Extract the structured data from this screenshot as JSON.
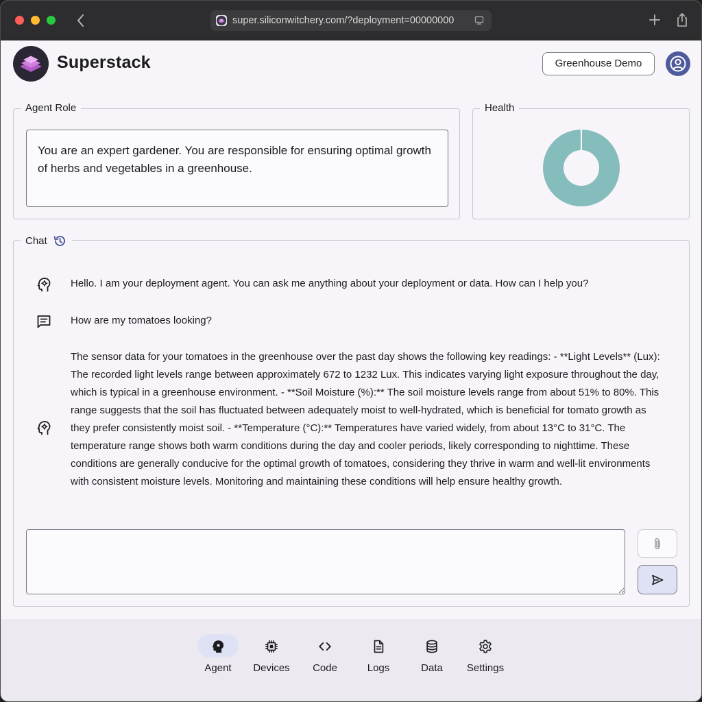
{
  "browser": {
    "url": "super.siliconwitchery.com/?deployment=00000000"
  },
  "header": {
    "brand": "Superstack",
    "deployment_button": "Greenhouse Demo"
  },
  "agent_role": {
    "legend": "Agent Role",
    "text": "You are an expert gardener. You are responsible for ensuring optimal growth of herbs and vegetables in a greenhouse."
  },
  "health": {
    "legend": "Health",
    "segments": [
      {
        "fraction": 0.99,
        "color": "#85bcbc"
      },
      {
        "fraction": 0.01,
        "color": "#ffffff"
      }
    ]
  },
  "chat": {
    "legend": "Chat",
    "messages": [
      {
        "role": "agent",
        "icon": "agent-head-icon",
        "text": "Hello. I am your deployment agent. You can ask me anything about your deployment or data. How can I help you?"
      },
      {
        "role": "user",
        "icon": "chat-bubble-icon",
        "text": "How are my tomatoes looking?"
      },
      {
        "role": "agent",
        "icon": "agent-head-icon",
        "text": "The sensor data for your tomatoes in the greenhouse over the past day shows the following key readings: - **Light Levels** (Lux): The recorded light levels range between approximately 672 to 1232 Lux. This indicates varying light exposure throughout the day, which is typical in a greenhouse environment. - **Soil Moisture (%):** The soil moisture levels range from about 51% to 80%. This range suggests that the soil has fluctuated between adequately moist to well-hydrated, which is beneficial for tomato growth as they prefer consistently moist soil. - **Temperature (°C):** Temperatures have varied widely, from about 13°C to 31°C. The temperature range shows both warm conditions during the day and cooler periods, likely corresponding to nighttime. These conditions are generally conducive for the optimal growth of tomatoes, considering they thrive in warm and well-lit environments with consistent moisture levels. Monitoring and maintaining these conditions will help ensure healthy growth."
      }
    ],
    "input_value": ""
  },
  "nav": {
    "items": [
      {
        "label": "Agent",
        "icon": "agent-head-icon",
        "active": true
      },
      {
        "label": "Devices",
        "icon": "chip-icon",
        "active": false
      },
      {
        "label": "Code",
        "icon": "code-icon",
        "active": false
      },
      {
        "label": "Logs",
        "icon": "document-icon",
        "active": false
      },
      {
        "label": "Data",
        "icon": "database-icon",
        "active": false
      },
      {
        "label": "Settings",
        "icon": "gear-icon",
        "active": false
      }
    ]
  },
  "colors": {
    "accent": "#4e5a9c",
    "health_ring": "#85bcbc",
    "nav_active": "#dfe1f5"
  }
}
